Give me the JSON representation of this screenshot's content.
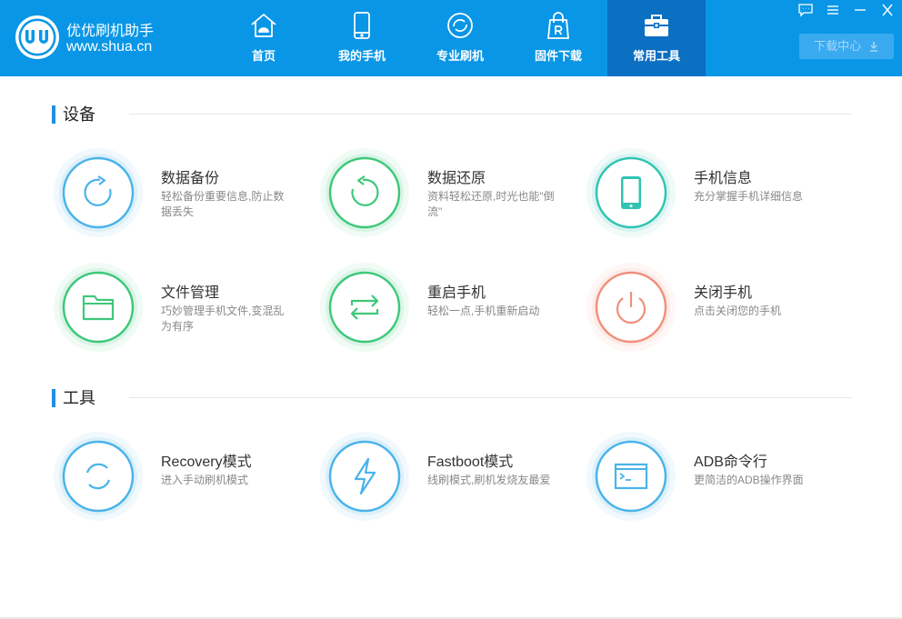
{
  "header": {
    "app_name": "优优刷机助手",
    "app_url": "www.shua.cn",
    "brand_color": "#0996e6",
    "active_tab_color": "#0b6fc2",
    "tabs": [
      {
        "label": "首页",
        "icon": "home-icon"
      },
      {
        "label": "我的手机",
        "icon": "phone-icon"
      },
      {
        "label": "专业刷机",
        "icon": "flash-icon"
      },
      {
        "label": "固件下载",
        "icon": "firmware-icon"
      },
      {
        "label": "常用工具",
        "icon": "toolbox-icon",
        "active": true
      }
    ],
    "download_center": "下载中心"
  },
  "sections": [
    {
      "title": "设备",
      "items": [
        {
          "name": "数据备份",
          "desc": "轻松备份重要信息,防止数据丢失",
          "icon": "backup-icon",
          "color": "#4ab3ea"
        },
        {
          "name": "数据还原",
          "desc": "资料轻松还原,时光也能\"倒流\"",
          "icon": "restore-icon",
          "color": "#3ec87a"
        },
        {
          "name": "手机信息",
          "desc": "充分掌握手机详细信息",
          "icon": "phone-info-icon",
          "color": "#2fc4b2"
        },
        {
          "name": "文件管理",
          "desc": "巧妙管理手机文件,变混乱为有序",
          "icon": "folder-icon",
          "color": "#3ec87a"
        },
        {
          "name": "重启手机",
          "desc": "轻松一点,手机重新启动",
          "icon": "reboot-icon",
          "color": "#3ec87a"
        },
        {
          "name": "关闭手机",
          "desc": "点击关闭您的手机",
          "icon": "power-icon",
          "color": "#f0907a"
        }
      ]
    },
    {
      "title": "工具",
      "items": [
        {
          "name": "Recovery模式",
          "desc": "进入手动刷机模式",
          "icon": "recovery-icon",
          "color": "#4ab3ea"
        },
        {
          "name": "Fastboot模式",
          "desc": "线刷模式,刷机发烧友最爱",
          "icon": "lightning-icon",
          "color": "#4ab3ea"
        },
        {
          "name": "ADB命令行",
          "desc": "更简洁的ADB操作界面",
          "icon": "terminal-icon",
          "color": "#4ab3ea"
        }
      ]
    }
  ]
}
